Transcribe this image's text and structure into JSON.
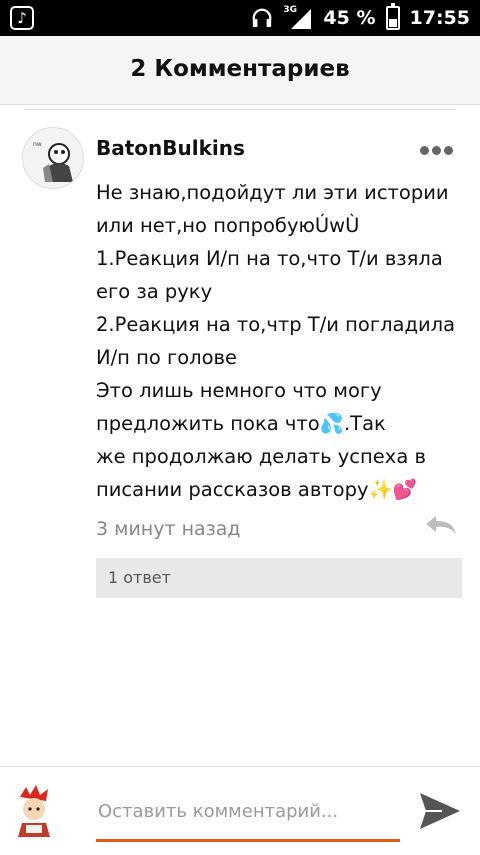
{
  "statusbar": {
    "battery_text": "45 %",
    "time": "17:55",
    "network": "3G",
    "battery_level": 0.45
  },
  "header": {
    "title": "2 Комментариев"
  },
  "comment": {
    "username": "BatonBulkins",
    "text": "Не знаю,подойдут ли эти истории или нет,но попробуюÚwÙ\n1.Реакция И/п на то,что Т/и взяла его за руку\n2.Реакция на то,чтр Т/и погладила И/п по голове\nЭто лишь немного что могу предложить пока что💦.Так\nже продолжаю делать успеха в писании рассказов автору✨💕",
    "timestamp": "3 минут назад",
    "replies_label": "1 ответ"
  },
  "composer": {
    "placeholder": "Оставить комментарий..."
  },
  "colors": {
    "accent": "#e45a1a",
    "statusbar": "#000000",
    "header_bg": "#f5f5f5"
  },
  "icons": [
    "music-app-icon",
    "headphones-icon",
    "signal-icon",
    "battery-icon",
    "more-options-icon",
    "reply-icon",
    "send-icon"
  ]
}
